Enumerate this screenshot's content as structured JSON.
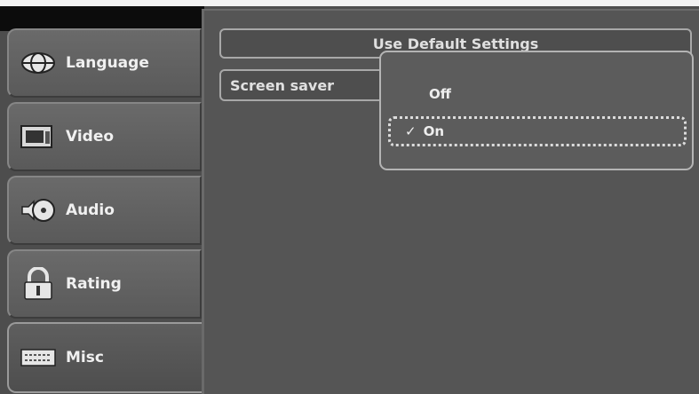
{
  "sidebar": {
    "items": [
      {
        "label": "Language",
        "icon": "language-globe-icon",
        "active": false
      },
      {
        "label": "Video",
        "icon": "tv-monitor-icon",
        "active": false
      },
      {
        "label": "Audio",
        "icon": "speaker-disc-icon",
        "active": false
      },
      {
        "label": "Rating",
        "icon": "padlock-icon",
        "active": false
      },
      {
        "label": "Misc",
        "icon": "keyboard-icon",
        "active": true
      }
    ]
  },
  "main": {
    "default_button_label": "Use Default Settings",
    "screensaver_label": "Screen saver",
    "dropdown": {
      "options": [
        {
          "label": "Off",
          "checked": false
        },
        {
          "label": "On",
          "checked": true
        }
      ],
      "check_glyph": "✓"
    }
  },
  "colors": {
    "screen_bg": "#4d4d4d",
    "tab_bg": "#666666",
    "text": "#eeeeee",
    "border_light": "#b4b4b4"
  }
}
